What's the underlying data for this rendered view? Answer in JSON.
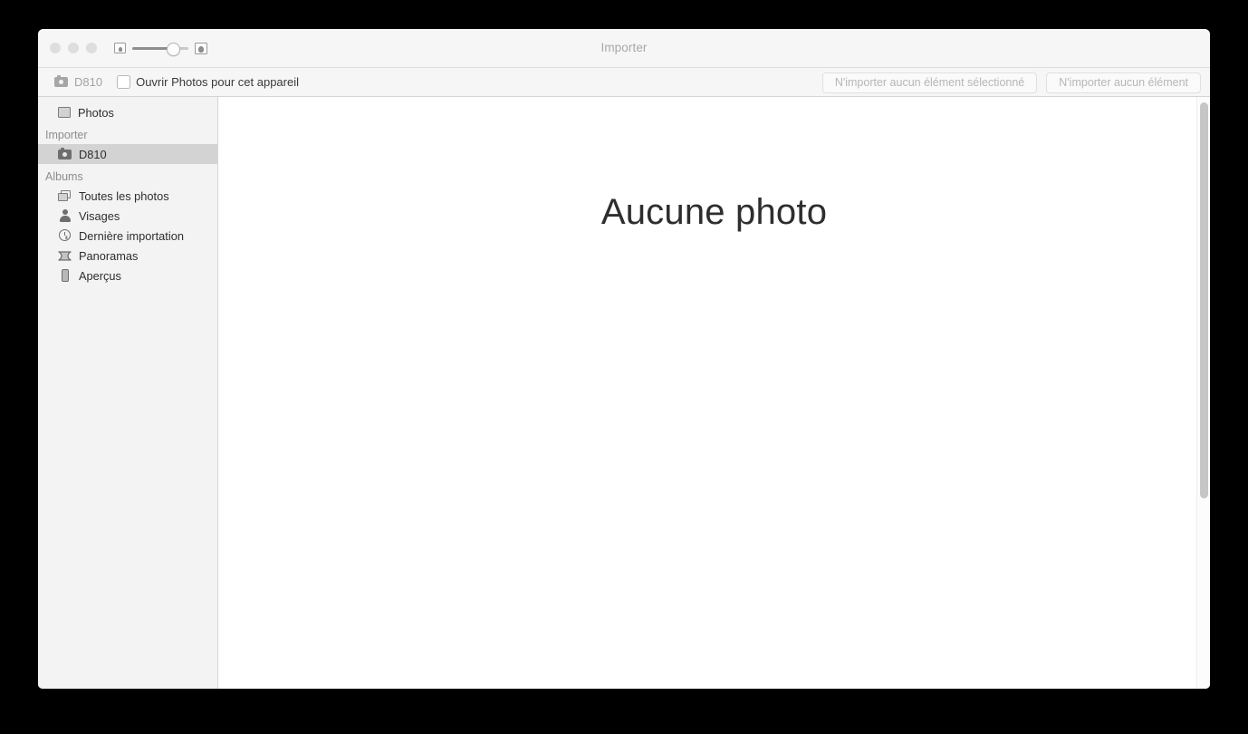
{
  "window": {
    "title": "Importer",
    "traffic_lights": [
      "close",
      "minimize",
      "zoom"
    ]
  },
  "titlebar": {
    "zoom_slider": {
      "small_icon": "small-thumbnail-icon",
      "large_icon": "large-thumbnail-icon",
      "value_percent": 70
    }
  },
  "import_bar": {
    "device_icon": "camera-icon",
    "device_name": "D810",
    "checkbox": {
      "label": "Ouvrir Photos pour cet appareil",
      "checked": false
    },
    "buttons": [
      {
        "label": "N'importer aucun élément sélectionné",
        "enabled": false
      },
      {
        "label": "N'importer aucun élément",
        "enabled": false
      }
    ]
  },
  "sidebar": {
    "top_items": [
      {
        "label": "Photos",
        "icon": "photos-icon",
        "selected": false
      }
    ],
    "sections": [
      {
        "header": "Importer",
        "items": [
          {
            "label": "D810",
            "icon": "camera-icon",
            "selected": true
          }
        ]
      },
      {
        "header": "Albums",
        "items": [
          {
            "label": "Toutes les photos",
            "icon": "all-photos-icon",
            "selected": false
          },
          {
            "label": "Visages",
            "icon": "faces-icon",
            "selected": false
          },
          {
            "label": "Dernière importation",
            "icon": "clock-icon",
            "selected": false
          },
          {
            "label": "Panoramas",
            "icon": "panorama-icon",
            "selected": false
          },
          {
            "label": "Aperçus",
            "icon": "preview-icon",
            "selected": false
          }
        ]
      }
    ]
  },
  "content": {
    "empty_message": "Aucune photo"
  },
  "colors": {
    "titlebar_bg": "#f6f6f6",
    "sidebar_bg": "#f3f3f3",
    "selection_bg": "#d3d3d3",
    "content_bg": "#ffffff",
    "disabled_text": "#b6b6b6"
  }
}
